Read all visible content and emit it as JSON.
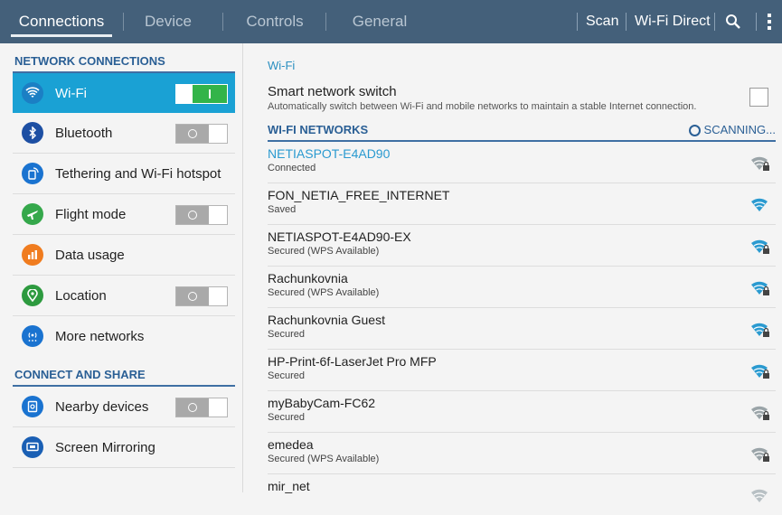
{
  "tabs": [
    "Connections",
    "Device",
    "Controls",
    "General"
  ],
  "actions": {
    "scan": "Scan",
    "wifi_direct": "Wi-Fi Direct",
    "search_icon": "search-icon",
    "more_icon": "overflow-menu-icon"
  },
  "left": {
    "network_header": "NETWORK CONNECTIONS",
    "items": [
      {
        "label": "Wi-Fi",
        "icon": "wifi-icon",
        "color": "#1a8bd3"
      },
      {
        "label": "Bluetooth",
        "icon": "bluetooth-icon",
        "color": "#1d4fa3"
      },
      {
        "label": "Tethering and Wi-Fi hotspot",
        "icon": "hotspot-icon",
        "color": "#1a73d0"
      },
      {
        "label": "Flight mode",
        "icon": "airplane-icon",
        "color": "#35a84b"
      },
      {
        "label": "Data usage",
        "icon": "data-usage-icon",
        "color": "#f07c1f"
      },
      {
        "label": "Location",
        "icon": "location-icon",
        "color": "#2d9a3f"
      },
      {
        "label": "More networks",
        "icon": "more-networks-icon",
        "color": "#1a73d0"
      }
    ],
    "share_header": "CONNECT AND SHARE",
    "share_items": [
      {
        "label": "Nearby devices",
        "icon": "nearby-devices-icon",
        "color": "#1a73d0"
      },
      {
        "label": "Screen Mirroring",
        "icon": "screen-mirroring-icon",
        "color": "#1a5fb4"
      }
    ]
  },
  "right": {
    "title": "Wi-Fi",
    "smart_switch": {
      "title": "Smart network switch",
      "desc": "Automatically switch between Wi-Fi and mobile networks to maintain a stable Internet connection."
    },
    "networks_header": "WI-FI NETWORKS",
    "scanning": "SCANNING...",
    "networks": [
      {
        "ssid": "NETIASPOT-E4AD90",
        "status": "Connected",
        "color": "#9aa4a8"
      },
      {
        "ssid": "FON_NETIA_FREE_INTERNET",
        "status": "Saved",
        "color": "#2a9ad0"
      },
      {
        "ssid": "NETIASPOT-E4AD90-EX",
        "status": "Secured (WPS Available)",
        "color": "#2a9ad0"
      },
      {
        "ssid": "Rachunkovnia",
        "status": "Secured (WPS Available)",
        "color": "#2a9ad0"
      },
      {
        "ssid": "Rachunkovnia Guest",
        "status": "Secured",
        "color": "#2a9ad0"
      },
      {
        "ssid": "HP-Print-6f-LaserJet Pro MFP",
        "status": "Secured",
        "color": "#2a9ad0"
      },
      {
        "ssid": "myBabyCam-FC62",
        "status": "Secured",
        "color": "#9aa4a8"
      },
      {
        "ssid": "emedea",
        "status": "Secured (WPS Available)",
        "color": "#9aa4a8"
      },
      {
        "ssid": "mir_net",
        "status": "",
        "color": "#b8c0c4"
      }
    ]
  }
}
